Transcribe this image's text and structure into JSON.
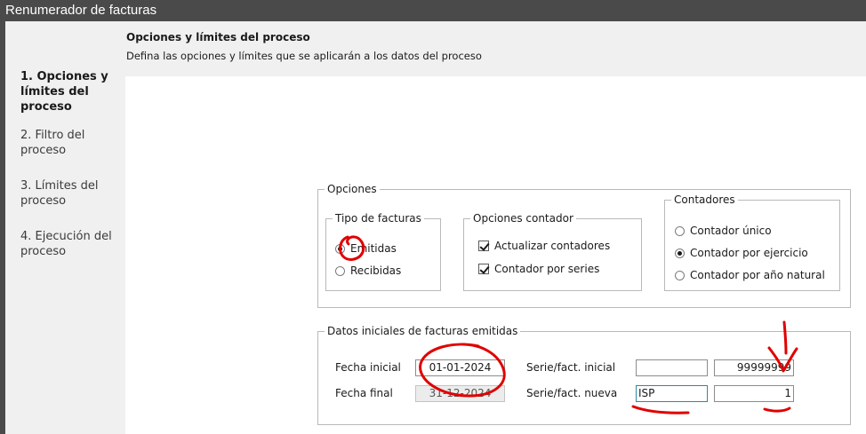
{
  "window": {
    "title": "Renumerador de facturas"
  },
  "header": {
    "title": "Opciones y límites del proceso",
    "description": "Defina las opciones y límites que se aplicarán a los datos del proceso"
  },
  "steps": [
    {
      "label": "1. Opciones y límites del proceso",
      "active": true
    },
    {
      "label": "2. Filtro del proceso",
      "active": false
    },
    {
      "label": "3. Límites del proceso",
      "active": false
    },
    {
      "label": "4. Ejecución del proceso",
      "active": false
    }
  ],
  "options": {
    "legend": "Opciones",
    "tipo": {
      "legend": "Tipo de facturas",
      "emitidas": "Emitidas",
      "recibidas": "Recibidas",
      "selected": "Emitidas"
    },
    "contador_opts": {
      "legend": "Opciones contador",
      "actualizar": "Actualizar contadores",
      "actualizar_checked": true,
      "por_series": "Contador por series",
      "por_series_checked": true
    },
    "contadores": {
      "legend": "Contadores",
      "unico": "Contador único",
      "ejercicio": "Contador por ejercicio",
      "anio_natural": "Contador por año natural",
      "selected": "Contador por ejercicio"
    }
  },
  "datos": {
    "legend": "Datos iniciales de facturas emitidas",
    "fecha_inicial_label": "Fecha inicial",
    "fecha_inicial": "01-01-2024",
    "fecha_final_label": "Fecha final",
    "fecha_final": "31-12-2024",
    "serie_inicial_label": "Serie/fact. inicial",
    "serie_inicial": "",
    "fact_inicial": "99999999",
    "serie_nueva_label": "Serie/fact. nueva",
    "serie_nueva": "ISP",
    "fact_nueva": "1"
  },
  "colors": {
    "titlebar": "#4a4a4a",
    "annotation": "#e00000"
  }
}
